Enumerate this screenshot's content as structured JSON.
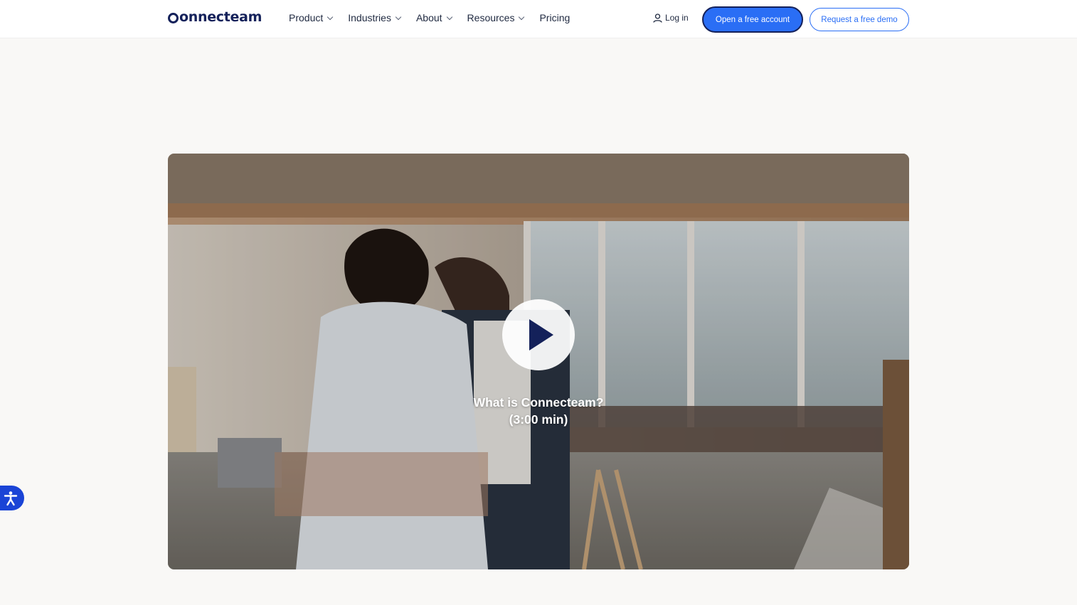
{
  "header": {
    "logo": "connecteam",
    "nav": [
      {
        "label": "Product",
        "dropdown": true
      },
      {
        "label": "Industries",
        "dropdown": true
      },
      {
        "label": "About",
        "dropdown": true
      },
      {
        "label": "Resources",
        "dropdown": true
      },
      {
        "label": "Pricing",
        "dropdown": false
      }
    ],
    "login_label": "Log in",
    "primary_cta": "Open a free account",
    "secondary_cta": "Request a free demo"
  },
  "video": {
    "title": "What is Connecteam?",
    "duration": "(3:00 min)"
  },
  "colors": {
    "brand_navy": "#14215a",
    "brand_blue": "#2a6ef5",
    "accessibility_blue": "#1a44d6",
    "page_background": "#f9f8f6"
  },
  "icons": [
    "user-icon",
    "chevron-down-icon",
    "play-icon",
    "accessibility-icon"
  ]
}
